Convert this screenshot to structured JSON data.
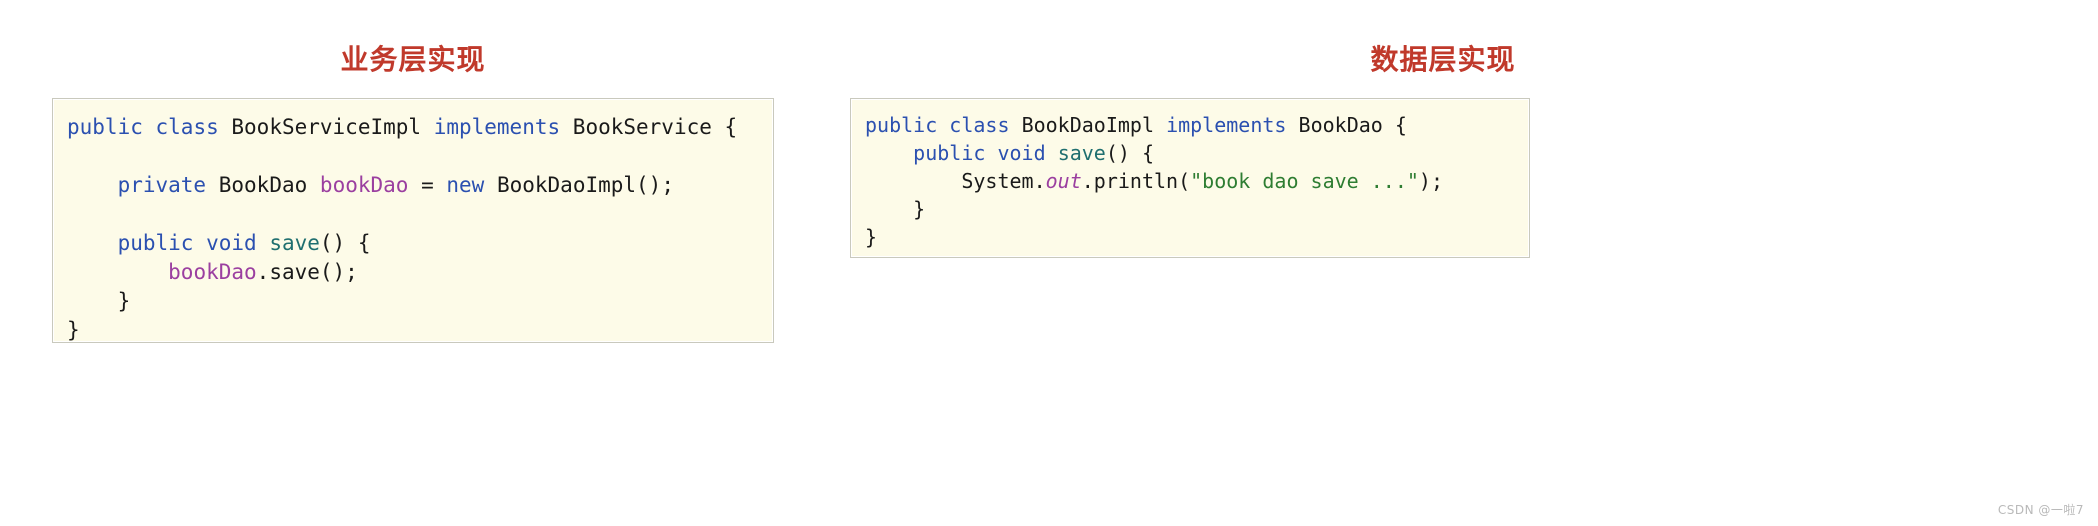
{
  "panels": [
    {
      "id": "service",
      "title": "业务层实现",
      "title_color": "#c0392b",
      "code_background": "#fdfbe8",
      "code_border": "#c9c9bd",
      "lines": [
        [
          {
            "t": "public",
            "c": "kw"
          },
          {
            "t": " ",
            "c": "punct"
          },
          {
            "t": "class",
            "c": "kw"
          },
          {
            "t": " ",
            "c": "punct"
          },
          {
            "t": "BookServiceImpl",
            "c": "type"
          },
          {
            "t": " ",
            "c": "punct"
          },
          {
            "t": "implements",
            "c": "kw"
          },
          {
            "t": " ",
            "c": "punct"
          },
          {
            "t": "BookService",
            "c": "type"
          },
          {
            "t": " {",
            "c": "punct"
          }
        ],
        [],
        [
          {
            "t": "    ",
            "c": "punct"
          },
          {
            "t": "private",
            "c": "kw"
          },
          {
            "t": " ",
            "c": "punct"
          },
          {
            "t": "BookDao",
            "c": "type"
          },
          {
            "t": " ",
            "c": "punct"
          },
          {
            "t": "bookDao",
            "c": "field"
          },
          {
            "t": " = ",
            "c": "punct"
          },
          {
            "t": "new",
            "c": "kw"
          },
          {
            "t": " ",
            "c": "punct"
          },
          {
            "t": "BookDaoImpl();",
            "c": "type"
          }
        ],
        [],
        [
          {
            "t": "    ",
            "c": "punct"
          },
          {
            "t": "public",
            "c": "kw"
          },
          {
            "t": " ",
            "c": "punct"
          },
          {
            "t": "void",
            "c": "kw"
          },
          {
            "t": " ",
            "c": "punct"
          },
          {
            "t": "save",
            "c": "method"
          },
          {
            "t": "() {",
            "c": "punct"
          }
        ],
        [
          {
            "t": "        ",
            "c": "punct"
          },
          {
            "t": "bookDao",
            "c": "field"
          },
          {
            "t": ".save();",
            "c": "punct"
          }
        ],
        [
          {
            "t": "    }",
            "c": "punct"
          }
        ],
        [
          {
            "t": "}",
            "c": "punct"
          }
        ]
      ]
    },
    {
      "id": "dao",
      "title": "数据层实现",
      "title_color": "#c0392b",
      "code_background": "#fdfbe8",
      "code_border": "#c9c9bd",
      "lines": [
        [
          {
            "t": "public",
            "c": "kw"
          },
          {
            "t": " ",
            "c": "punct"
          },
          {
            "t": "class",
            "c": "kw"
          },
          {
            "t": " ",
            "c": "punct"
          },
          {
            "t": "BookDaoImpl",
            "c": "type"
          },
          {
            "t": " ",
            "c": "punct"
          },
          {
            "t": "implements",
            "c": "kw"
          },
          {
            "t": " ",
            "c": "punct"
          },
          {
            "t": "BookDao",
            "c": "type"
          },
          {
            "t": " {",
            "c": "punct"
          }
        ],
        [
          {
            "t": "    ",
            "c": "punct"
          },
          {
            "t": "public",
            "c": "kw"
          },
          {
            "t": " ",
            "c": "punct"
          },
          {
            "t": "void",
            "c": "kw"
          },
          {
            "t": " ",
            "c": "punct"
          },
          {
            "t": "save",
            "c": "method"
          },
          {
            "t": "() {",
            "c": "punct"
          }
        ],
        [
          {
            "t": "        ",
            "c": "punct"
          },
          {
            "t": "System",
            "c": "type"
          },
          {
            "t": ".",
            "c": "punct"
          },
          {
            "t": "out",
            "c": "static"
          },
          {
            "t": ".println(",
            "c": "punct"
          },
          {
            "t": "\"book dao save ...\"",
            "c": "str"
          },
          {
            "t": ");",
            "c": "punct"
          }
        ],
        [
          {
            "t": "    }",
            "c": "punct"
          }
        ],
        [
          {
            "t": "}",
            "c": "punct"
          }
        ]
      ]
    }
  ],
  "watermark": "CSDN @一啦7"
}
